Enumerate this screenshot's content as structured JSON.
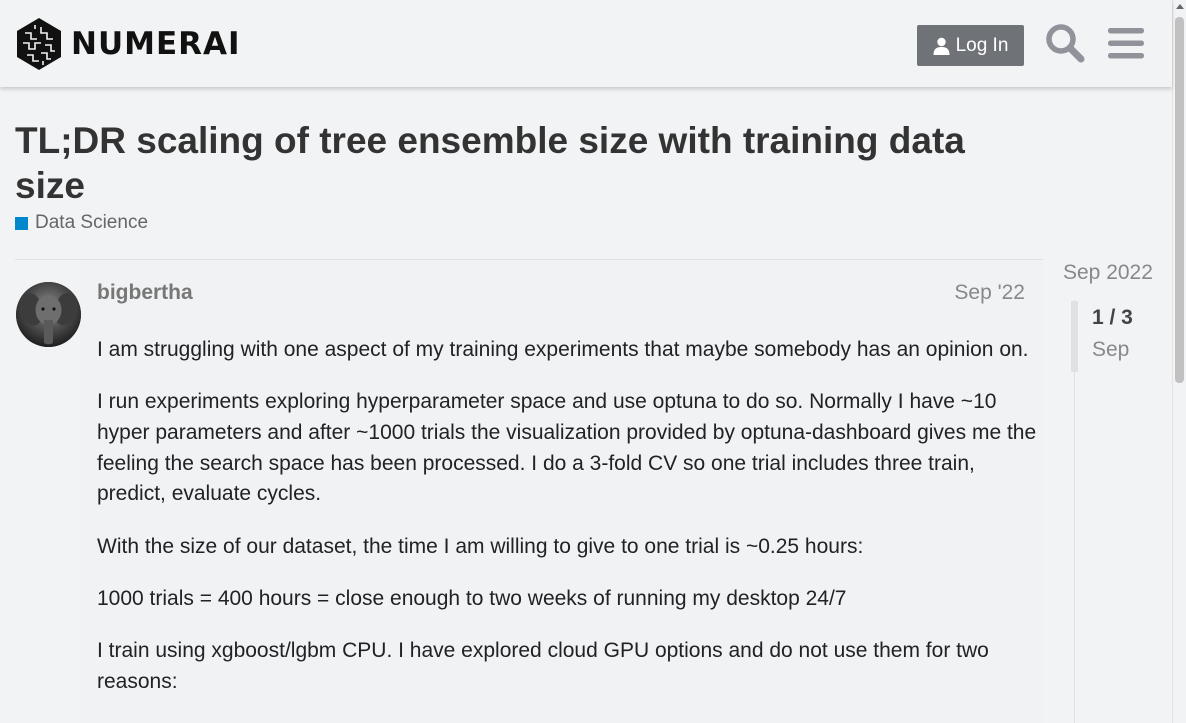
{
  "header": {
    "brand": "NUMERAI",
    "login_label": "Log In"
  },
  "topic": {
    "title": "TL;DR scaling of tree ensemble size with training data size",
    "category": "Data Science",
    "category_color": "#0088cc"
  },
  "post": {
    "username": "bigbertha",
    "date": "Sep '22",
    "paragraphs": [
      "I am struggling with one aspect of my training experiments that maybe somebody has an opinion on.",
      "I run experiments exploring hyperparameter space and use optuna to do so. Normally I have ~10 hyper parameters and after ~1000 trials the visualization provided by optuna-dashboard gives me the feeling the search space has been processed. I do a 3-fold CV so one trial includes three train, predict, evaluate cycles.",
      "With the size of our dataset, the time I am willing to give to one trial is ~0.25 hours:",
      "1000 trials = 400 hours = close enough to two weeks of running my desktop 24/7",
      "I train using xgboost/lgbm CPU. I have explored cloud GPU options and do not use them for two reasons:"
    ]
  },
  "timeline": {
    "top_date": "Sep 2022",
    "position": "1 / 3",
    "current_date": "Sep"
  },
  "icons": {
    "logo": "numerai-logo-icon",
    "user": "user-icon",
    "search": "search-icon",
    "menu": "hamburger-menu-icon"
  }
}
